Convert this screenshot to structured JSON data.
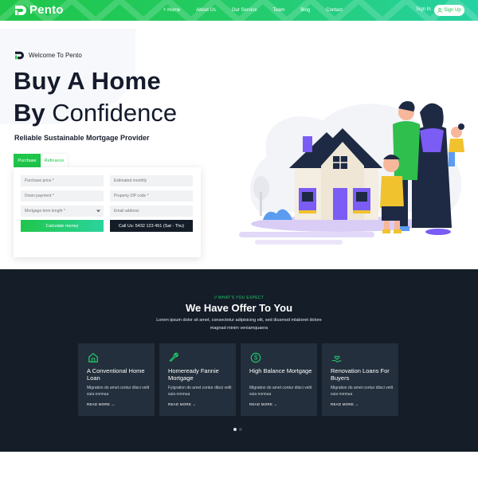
{
  "brand": {
    "name": "Pento",
    "accent": "#1fc64a",
    "accent_end": "#27d2a3",
    "dark": "#141d28"
  },
  "nav": {
    "items": [
      "+ Home",
      "About Us",
      "Our Service",
      "Team",
      "Blog",
      "Contact"
    ],
    "signin": "Sign In",
    "signup": "Sign Up"
  },
  "hero": {
    "welcome": "Welcome To Pento",
    "title_line1": "Buy A Home",
    "title_line2_bold": "By",
    "title_line2_rest": " Confidence",
    "subtitle": "Reliable Sustainable Mortgage Provider",
    "tabs": [
      "Purchase",
      "Refinance"
    ],
    "fields": {
      "purchase_price": "Purchase price *",
      "estimated_monthly": "Estimated monthly",
      "down_payment": "Down payment *",
      "zip": "Property ZIP code *",
      "term": "Mortgage term length *",
      "email": "Email address"
    },
    "calc_button": "Calculate money",
    "call_button": "Call Us: 5432 123 451 (Sat - Thu)"
  },
  "offer": {
    "eyebrow": "// WHAT'S YOU EXPECT",
    "title": "We Have Offer To You",
    "desc": "Lorem ipsum dolor sit amet, consectetur adipisicing elit, sed diusmod mlaboret dolore magnad minim veniamquaera",
    "cards": [
      {
        "icon": "home-icon",
        "title": "A Conventional Home Loan",
        "desc": "Migration do amet contur diisci velit suia nonnua",
        "link": "READ MORE"
      },
      {
        "icon": "wrench-icon",
        "title": "Homeready Fannie Mortgage",
        "desc": "Fyigration do amet contur diisci velit suia nonnua",
        "link": "READ MORE"
      },
      {
        "icon": "dollar-icon",
        "title": "High Balance Mortgage",
        "desc": "Migration do amet contur diisci velit suia nonnua",
        "link": "READ MORE"
      },
      {
        "icon": "hand-heart-icon",
        "title": "Renovation Loans For Buyers",
        "desc": "Migration do amet contur diisci velit suia nonnua",
        "link": "READ MORE"
      }
    ]
  }
}
